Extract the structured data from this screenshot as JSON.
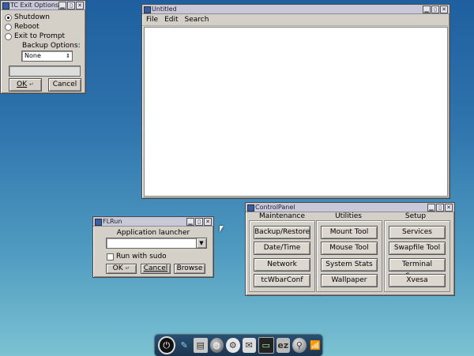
{
  "exit_dialog": {
    "title": "TC Exit Options",
    "options": [
      "Shutdown",
      "Reboot",
      "Exit to Prompt"
    ],
    "selected": "Shutdown",
    "backup_label": "Backup Options:",
    "backup_value": "None",
    "ok": "OK",
    "cancel": "Cancel"
  },
  "editor": {
    "title": "Untitled",
    "menu": [
      "File",
      "Edit",
      "Search"
    ]
  },
  "flrun": {
    "title": "FLRun",
    "heading": "Application launcher",
    "input_value": "",
    "sudo_label": "Run with sudo",
    "ok": "OK",
    "cancel": "Cancel",
    "browse": "Browse"
  },
  "control_panel": {
    "title": "ControlPanel",
    "columns": [
      {
        "header": "Maintenance",
        "items": [
          "Backup/Restore",
          "Date/Time",
          "Network",
          "tcWbarConf"
        ]
      },
      {
        "header": "Utilities",
        "items": [
          "Mount Tool",
          "Mouse Tool",
          "System Stats",
          "Wallpaper"
        ]
      },
      {
        "header": "Setup",
        "items": [
          "Services",
          "Swapfile Tool",
          "Terminal Server",
          "Xvesa"
        ]
      }
    ]
  },
  "dock_icons": [
    "power-icon",
    "pen-icon",
    "editor-icon",
    "globe-icon",
    "settings-icon",
    "mail-icon",
    "terminal-icon",
    "ez-icon",
    "search-icon",
    "wifi-icon"
  ]
}
